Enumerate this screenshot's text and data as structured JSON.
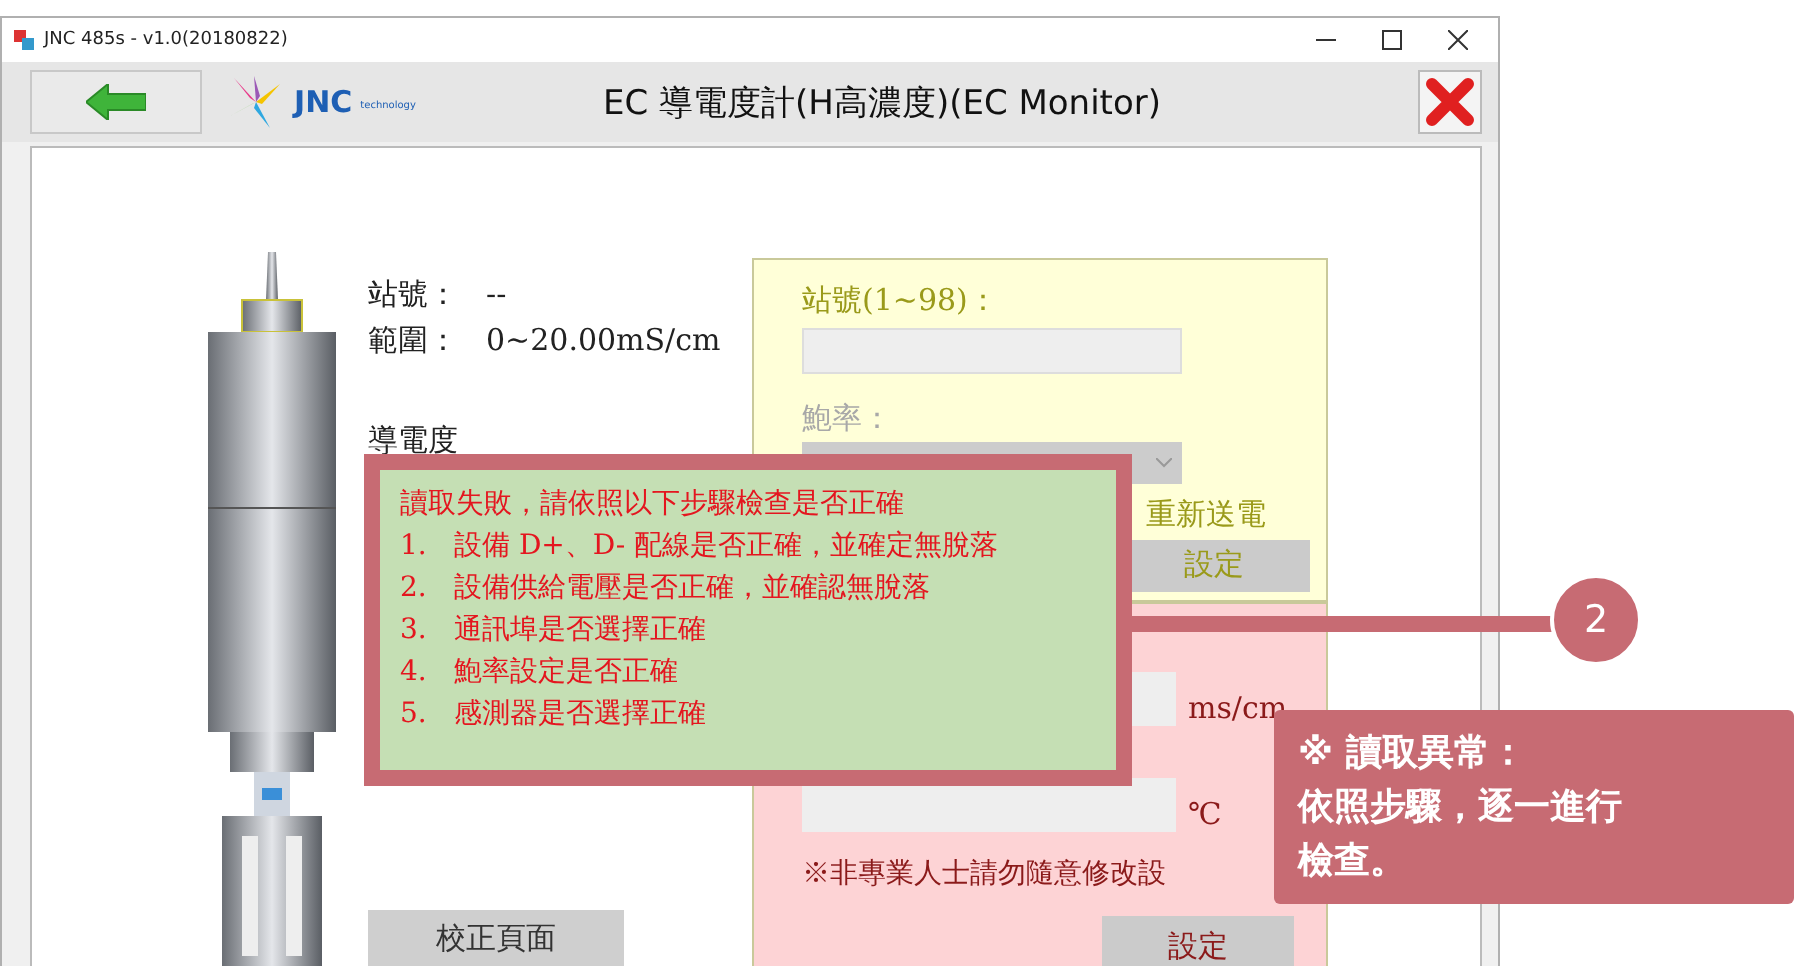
{
  "window": {
    "title": "JNC 485s - v1.0(20180822)"
  },
  "header": {
    "logo_text": "JNC",
    "logo_subtext": "technology",
    "title": "EC 導電度計(H高濃度)(EC Monitor)"
  },
  "info": [
    {
      "label": "站號：",
      "value": "--"
    },
    {
      "label": "範圍：",
      "value": "0~20.00mS/cm"
    }
  ],
  "reading_label": "導電度",
  "settings_panel": {
    "station_label": "站號(1~98)：",
    "baud_label": "鮑率：",
    "power_note": "重新送電",
    "button": "設定"
  },
  "calibration_panel": {
    "conductivity_unit": "ms/cm",
    "temperature_unit": "℃",
    "warning": "※非專業人士請勿隨意修改設",
    "button": "設定"
  },
  "calibration_button": "校正頁面",
  "error_popup": {
    "title": "讀取失敗，請依照以下步驟檢查是否正確",
    "steps": [
      {
        "number": "1.",
        "text": "設備 D+、D- 配線是否正確，並確定無脫落"
      },
      {
        "number": "2.",
        "text": "設備供給電壓是否正確，並確認無脫落"
      },
      {
        "number": "3.",
        "text": "通訊埠是否選擇正確"
      },
      {
        "number": "4.",
        "text": "鮑率設定是否正確"
      },
      {
        "number": "5.",
        "text": "感測器是否選擇正確"
      }
    ]
  },
  "annotation": {
    "number": "2",
    "lines": [
      "※ 讀取異常：",
      "依照步驟，逐一進行",
      "檢查。"
    ]
  }
}
